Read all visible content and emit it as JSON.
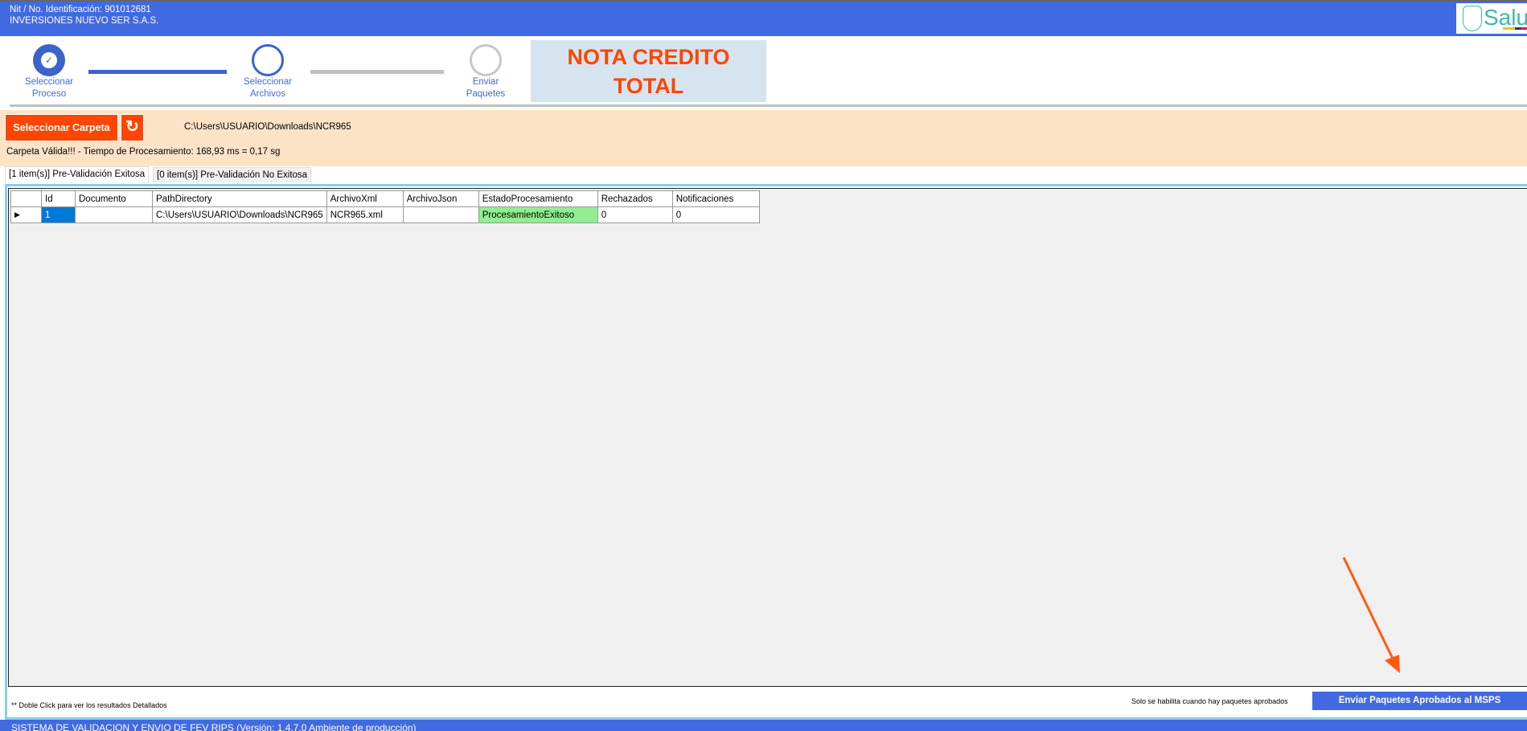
{
  "header": {
    "nit": "Nit / No. Identificación: 901012681",
    "company": "INVERSIONES NUEVO SER S.A.S.",
    "logo_text": "Salud"
  },
  "stepper": [
    {
      "label1": "Seleccionar",
      "label2": "Proceso",
      "state": "done"
    },
    {
      "label1": "Seleccionar",
      "label2": "Archivos",
      "state": "active"
    },
    {
      "label1": "Enviar",
      "label2": "Paquetes",
      "state": "pending"
    }
  ],
  "banner": {
    "line1": "NOTA CREDITO",
    "line2": "TOTAL"
  },
  "folder": {
    "button": "Seleccionar Carpeta",
    "refresh_icon": "refresh-icon",
    "path": "C:\\Users\\USUARIO\\Downloads\\NCR965",
    "status": "Carpeta Válida!!! - Tiempo de Procesamiento: 168,93 ms = 0,17 sg"
  },
  "tabs": [
    "[1 item(s)] Pre-Validación Exitosa",
    "[0 item(s)] Pre-Validación No Exitosa"
  ],
  "table": {
    "columns": [
      "Id",
      "Documento",
      "PathDirectory",
      "ArchivoXml",
      "ArchivoJson",
      "EstadoProcesamiento",
      "Rechazados",
      "Notificaciones"
    ],
    "rows": [
      [
        "1",
        "",
        "C:\\Users\\USUARIO\\Downloads\\NCR965",
        "NCR965.xml",
        "",
        "ProcesamientoExitoso",
        "0",
        "0"
      ]
    ]
  },
  "bottom": {
    "hint": "** Doble Click para ver los resultados Detallados",
    "enable_note": "Solo se habilita cuando hay paquetes aprobados",
    "send_button": "Enviar Paquetes Aprobados al MSPS"
  },
  "footer": "SISTEMA DE VALIDACION Y ENVIO DE FEV RIPS (Versión: 1.4.7.0 Ambiente de producción)",
  "colors": {
    "primary": "#4169E1",
    "accent": "#FF4500",
    "success": "#90EE90"
  }
}
